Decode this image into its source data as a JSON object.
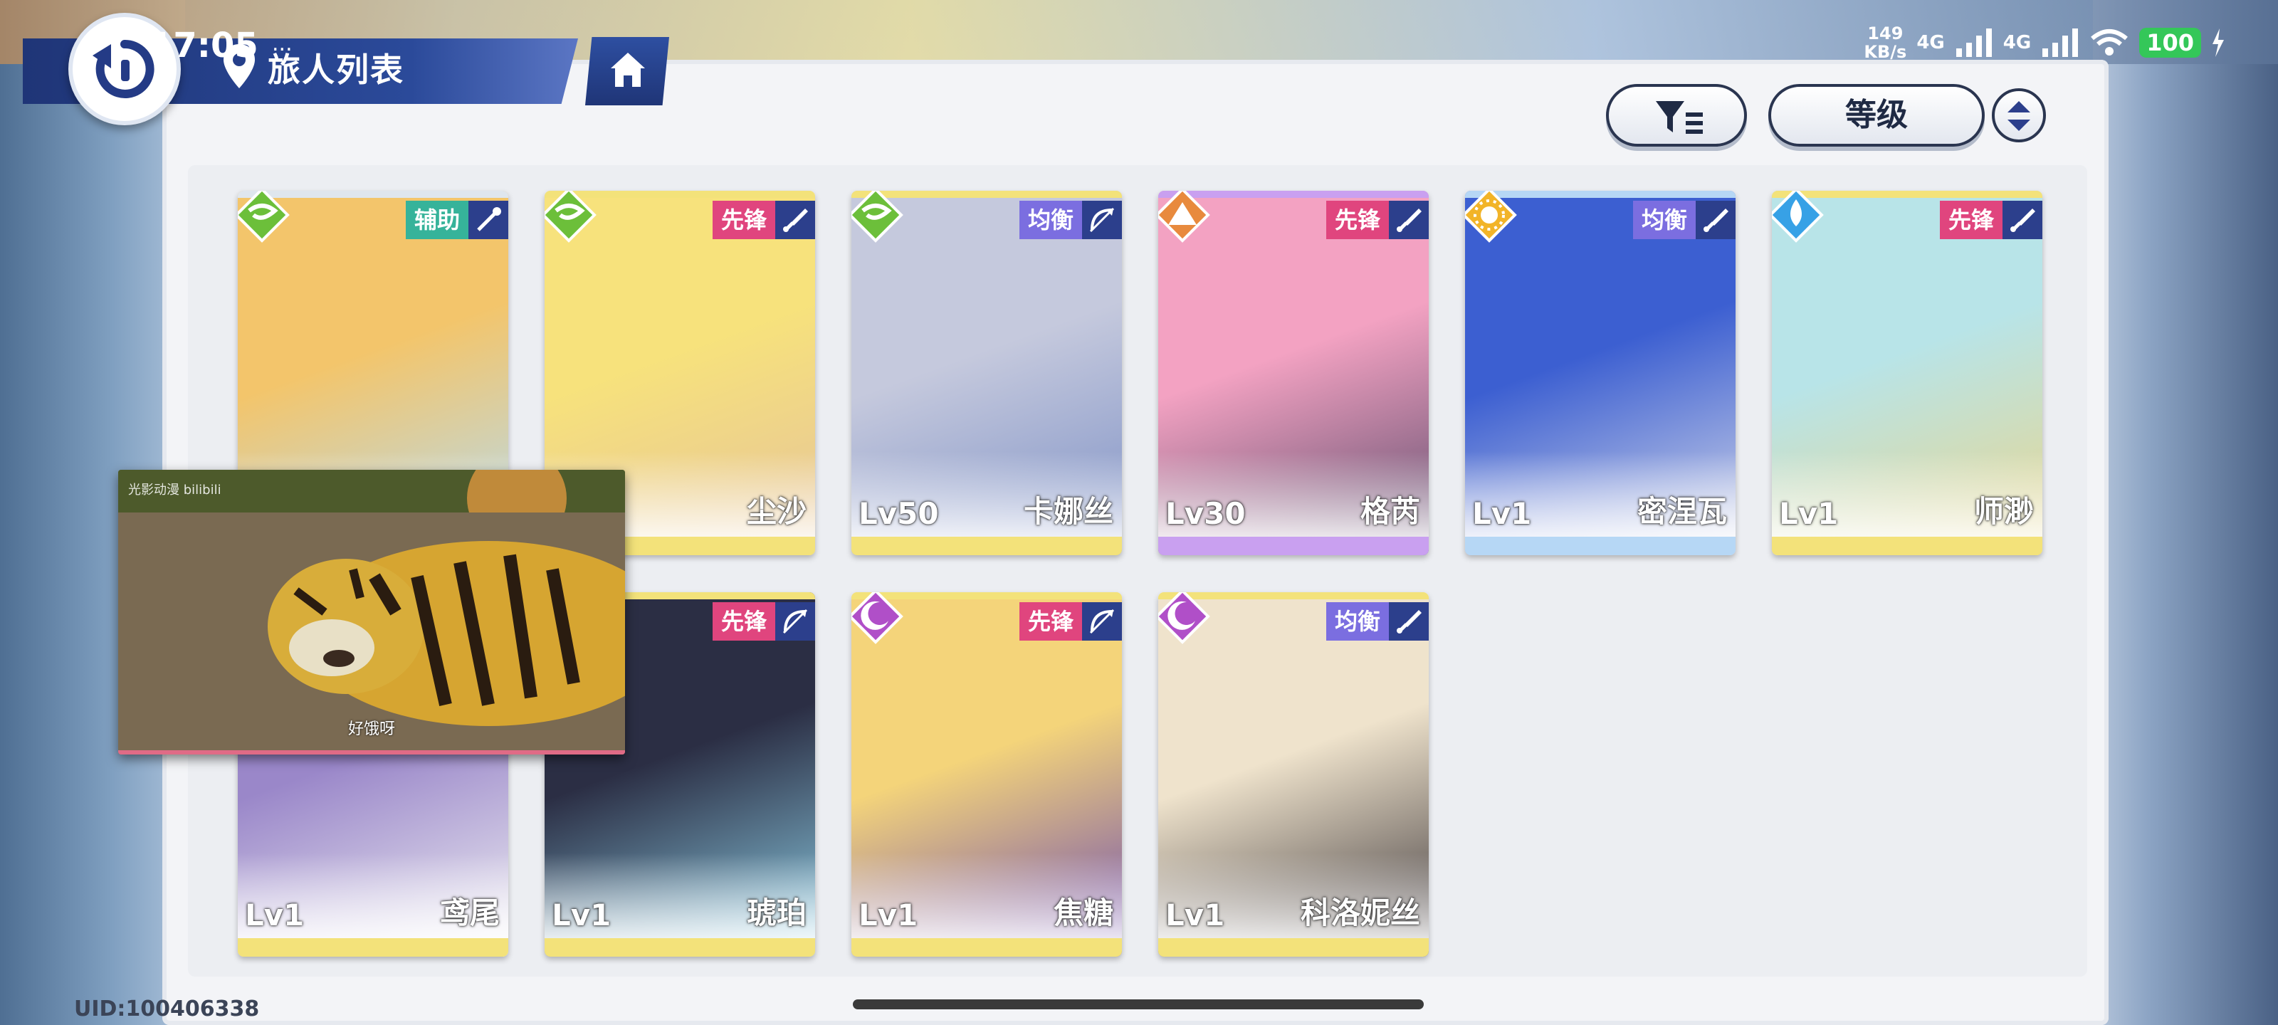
{
  "status_bar": {
    "time": "17:05",
    "dots": "...",
    "speed_value": "149",
    "speed_unit": "KB/s",
    "net1": "4G",
    "net2": "4G",
    "battery": "100"
  },
  "header": {
    "title": "旅人列表"
  },
  "toolbar": {
    "sort_label": "等级"
  },
  "colors": {
    "support": "#36b39a",
    "vanguard": "#e0457e",
    "balanced": "#7b6ee0",
    "icon_bg": "#2c3f8c"
  },
  "cards": [
    {
      "name": "",
      "level": "",
      "role": "辅助",
      "role_color": "#36b39a",
      "element": "wind-icon",
      "element_color": "#6cbf3a",
      "art": [
        "#f3c56b",
        "#b6dbf0"
      ],
      "stripe": "#dfe6ee",
      "weapon": "staff-icon"
    },
    {
      "name": "尘沙",
      "level": "",
      "role": "先锋",
      "role_color": "#e0457e",
      "element": "wind-icon",
      "element_color": "#6cbf3a",
      "art": [
        "#f7e27c",
        "#e4c29a"
      ],
      "stripe": "#f3e27a",
      "weapon": "sword-icon"
    },
    {
      "name": "卡娜丝",
      "level": "Lv50",
      "role": "均衡",
      "role_color": "#7b6ee0",
      "element": "wind-icon",
      "element_color": "#6cbf3a",
      "art": [
        "#c5c9dd",
        "#7d90c5"
      ],
      "stripe": "#f3e27a",
      "weapon": "bow-icon"
    },
    {
      "name": "格芮",
      "level": "Lv30",
      "role": "先锋",
      "role_color": "#e0457e",
      "element": "mountain-icon",
      "element_color": "#e88a3d",
      "art": [
        "#f3a2c2",
        "#5a4a6a"
      ],
      "stripe": "#c9a0f0",
      "weapon": "sword-icon"
    },
    {
      "name": "密涅瓦",
      "level": "Lv1",
      "role": "均衡",
      "role_color": "#7b6ee0",
      "element": "sun-icon",
      "element_color": "#f2b428",
      "art": [
        "#3c5fd1",
        "#d7dbea"
      ],
      "stripe": "#b6d7f5",
      "weapon": "sword-icon"
    },
    {
      "name": "师渺",
      "level": "Lv1",
      "role": "先锋",
      "role_color": "#e0457e",
      "element": "water-icon",
      "element_color": "#37a1e6",
      "art": [
        "#b8e4e8",
        "#e9d58c"
      ],
      "stripe": "#f3e27a",
      "weapon": "sword-icon"
    },
    {
      "name": "鸢尾",
      "level": "Lv1",
      "role": "",
      "role_color": "#e0457e",
      "element": "",
      "element_color": "#b04fc8",
      "art": [
        "#9a87c9",
        "#f1f1f4"
      ],
      "stripe": "#f3e27a",
      "weapon": ""
    },
    {
      "name": "琥珀",
      "level": "Lv1",
      "role": "先锋",
      "role_color": "#e0457e",
      "element": "",
      "element_color": "#b04fc8",
      "art": [
        "#2b2e44",
        "#8fd0e7"
      ],
      "stripe": "#f3e27a",
      "weapon": "bow-icon"
    },
    {
      "name": "焦糖",
      "level": "Lv1",
      "role": "先锋",
      "role_color": "#e0457e",
      "element": "moon-icon",
      "element_color": "#b04fc8",
      "art": [
        "#f4d47a",
        "#6b4ab0"
      ],
      "stripe": "#f3e27a",
      "weapon": "bow-icon"
    },
    {
      "name": "科洛妮丝",
      "level": "Lv1",
      "role": "均衡",
      "role_color": "#7b6ee0",
      "element": "moon-icon",
      "element_color": "#b04fc8",
      "art": [
        "#efe3cc",
        "#3a3438"
      ],
      "stripe": "#f3e27a",
      "weapon": "sword-icon"
    }
  ],
  "pip_video": {
    "watermark": "光影动漫 bilibili",
    "caption": "好饿呀"
  },
  "footer": {
    "uid": "UID:100406338"
  }
}
